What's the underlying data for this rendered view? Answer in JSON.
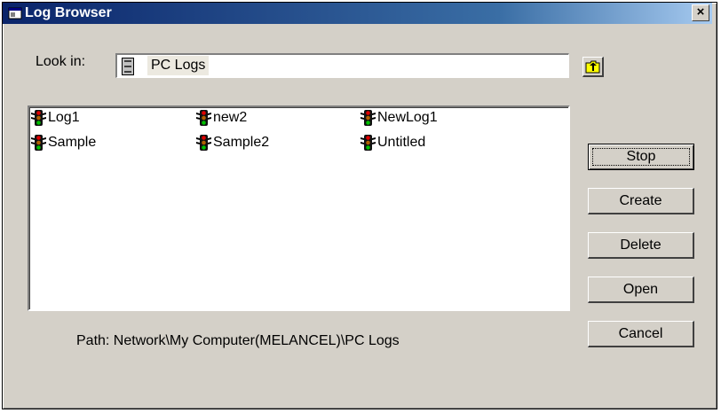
{
  "window": {
    "title": "Log Browser",
    "close_glyph": "×",
    "icon": "window-icon"
  },
  "lookin": {
    "label": "Look in:",
    "value": "PC Logs",
    "icon": "drive-icon",
    "up_icon": "folder-up-icon"
  },
  "files": [
    {
      "name": "Log1",
      "icon": "traffic-light-icon"
    },
    {
      "name": "new2",
      "icon": "traffic-light-icon"
    },
    {
      "name": "NewLog1",
      "icon": "traffic-light-icon"
    },
    {
      "name": "Sample",
      "icon": "traffic-light-icon"
    },
    {
      "name": "Sample2",
      "icon": "traffic-light-icon"
    },
    {
      "name": "Untitled",
      "icon": "traffic-light-icon"
    }
  ],
  "buttons": {
    "stop": "Stop",
    "create": "Create",
    "delete": "Delete",
    "open": "Open",
    "cancel": "Cancel"
  },
  "path": {
    "text": "Path:  Network\\My Computer(MELANCEL)\\PC Logs"
  },
  "colors": {
    "title_start": "#0a246a",
    "title_end": "#a6caf0",
    "face": "#d4d0c8"
  }
}
